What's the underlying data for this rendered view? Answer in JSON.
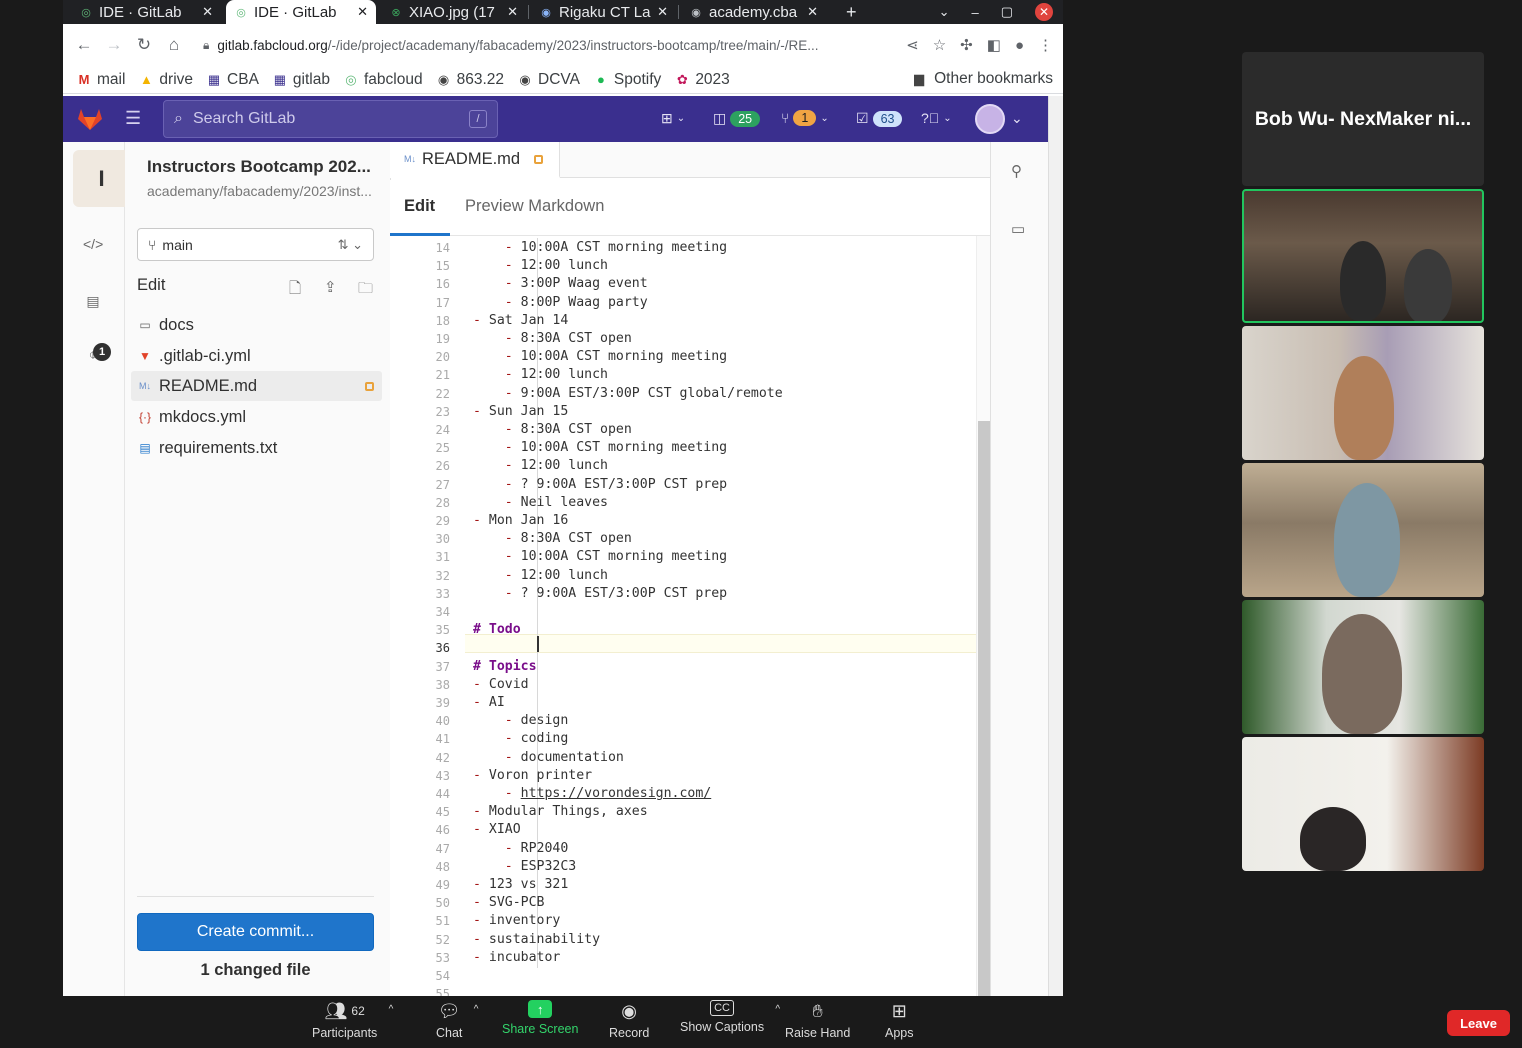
{
  "browser": {
    "tabs": [
      {
        "label": "IDE · GitLab",
        "active": false
      },
      {
        "label": "IDE · GitLab",
        "active": true
      },
      {
        "label": "XIAO.jpg (17",
        "active": false
      },
      {
        "label": "Rigaku CT La",
        "active": false
      },
      {
        "label": "academy.cba",
        "active": false
      }
    ],
    "new_tab": "+",
    "url_host": "gitlab.fabcloud.org",
    "url_path": "/-/ide/project/academany/fabacademy/2023/instructors-bootcamp/tree/main/-/RE...",
    "bookmarks": [
      "mail",
      "drive",
      "CBA",
      "gitlab",
      "fabcloud",
      "863.22",
      "DCVA",
      "Spotify",
      "2023"
    ],
    "other_bookmarks": "Other bookmarks"
  },
  "gitlab": {
    "search_placeholder": "Search GitLab",
    "search_shortcut": "/",
    "issues_count": "25",
    "mr_count": "1",
    "todo_count": "63",
    "project_initial": "I",
    "project_name": "Instructors Bootcamp 202...",
    "project_path": "academany/fabacademy/2023/inst...",
    "branch": "main",
    "edit_label": "Edit",
    "rail_badge": "1",
    "files": [
      {
        "name": "docs",
        "icon": "folder-icon"
      },
      {
        "name": ".gitlab-ci.yml",
        "icon": "gitlab-icon"
      },
      {
        "name": "README.md",
        "icon": "markdown-icon",
        "selected": true,
        "modified": true
      },
      {
        "name": "mkdocs.yml",
        "icon": "yaml-icon"
      },
      {
        "name": "requirements.txt",
        "icon": "text-file-icon"
      }
    ],
    "create_commit": "Create commit...",
    "changed_files": "1 changed file",
    "file_tab": "README.md",
    "mode_edit": "Edit",
    "mode_preview": "Preview Markdown"
  },
  "editor": {
    "current_line": 36,
    "lines": [
      {
        "n": "14",
        "t": "    - 10:00A CST morning meeting"
      },
      {
        "n": "15",
        "t": "    - 12:00 lunch"
      },
      {
        "n": "16",
        "t": "    - 3:00P Waag event"
      },
      {
        "n": "17",
        "t": "    - 8:00P Waag party"
      },
      {
        "n": "18",
        "t": "- Sat Jan 14"
      },
      {
        "n": "19",
        "t": "    - 8:30A CST open"
      },
      {
        "n": "20",
        "t": "    - 10:00A CST morning meeting"
      },
      {
        "n": "21",
        "t": "    - 12:00 lunch"
      },
      {
        "n": "22",
        "t": "    - 9:00A EST/3:00P CST global/remote"
      },
      {
        "n": "23",
        "t": "- Sun Jan 15"
      },
      {
        "n": "24",
        "t": "    - 8:30A CST open"
      },
      {
        "n": "25",
        "t": "    - 10:00A CST morning meeting"
      },
      {
        "n": "26",
        "t": "    - 12:00 lunch"
      },
      {
        "n": "27",
        "t": "    - ? 9:00A EST/3:00P CST prep"
      },
      {
        "n": "28",
        "t": "    - Neil leaves"
      },
      {
        "n": "29",
        "t": "- Mon Jan 16"
      },
      {
        "n": "30",
        "t": "    - 8:30A CST open"
      },
      {
        "n": "31",
        "t": "    - 10:00A CST morning meeting"
      },
      {
        "n": "32",
        "t": "    - 12:00 lunch"
      },
      {
        "n": "33",
        "t": "    - ? 9:00A EST/3:00P CST prep"
      },
      {
        "n": "34",
        "t": ""
      },
      {
        "n": "35",
        "t": "# Todo"
      },
      {
        "n": "36",
        "t": ""
      },
      {
        "n": "37",
        "t": "# Topics"
      },
      {
        "n": "38",
        "t": "- Covid"
      },
      {
        "n": "39",
        "t": "- AI"
      },
      {
        "n": "40",
        "t": "    - design"
      },
      {
        "n": "41",
        "t": "    - coding"
      },
      {
        "n": "42",
        "t": "    - documentation"
      },
      {
        "n": "43",
        "t": "- Voron printer"
      },
      {
        "n": "44",
        "t": "    - https://vorondesign.com/"
      },
      {
        "n": "45",
        "t": "- Modular Things, axes"
      },
      {
        "n": "46",
        "t": "- XIAO"
      },
      {
        "n": "47",
        "t": "    - RP2040"
      },
      {
        "n": "48",
        "t": "    - ESP32C3"
      },
      {
        "n": "49",
        "t": "- 123 vs 321"
      },
      {
        "n": "50",
        "t": "- SVG-PCB"
      },
      {
        "n": "51",
        "t": "- inventory"
      },
      {
        "n": "52",
        "t": "- sustainability"
      },
      {
        "n": "53",
        "t": "- incubator"
      },
      {
        "n": "54",
        "t": ""
      },
      {
        "n": "55",
        "t": ""
      }
    ]
  },
  "zoom": {
    "speaker_name": "Bob Wu- NexMaker ni...",
    "participants_count": "62",
    "buttons": [
      "Participants",
      "Chat",
      "Share Screen",
      "Record",
      "Show Captions",
      "Raise Hand",
      "Apps"
    ],
    "leave": "Leave"
  },
  "colors": {
    "gitlab_header": "#3a2f8e",
    "primary_button": "#1f75cb",
    "share_green": "#23d160",
    "leave_red": "#e02828"
  }
}
